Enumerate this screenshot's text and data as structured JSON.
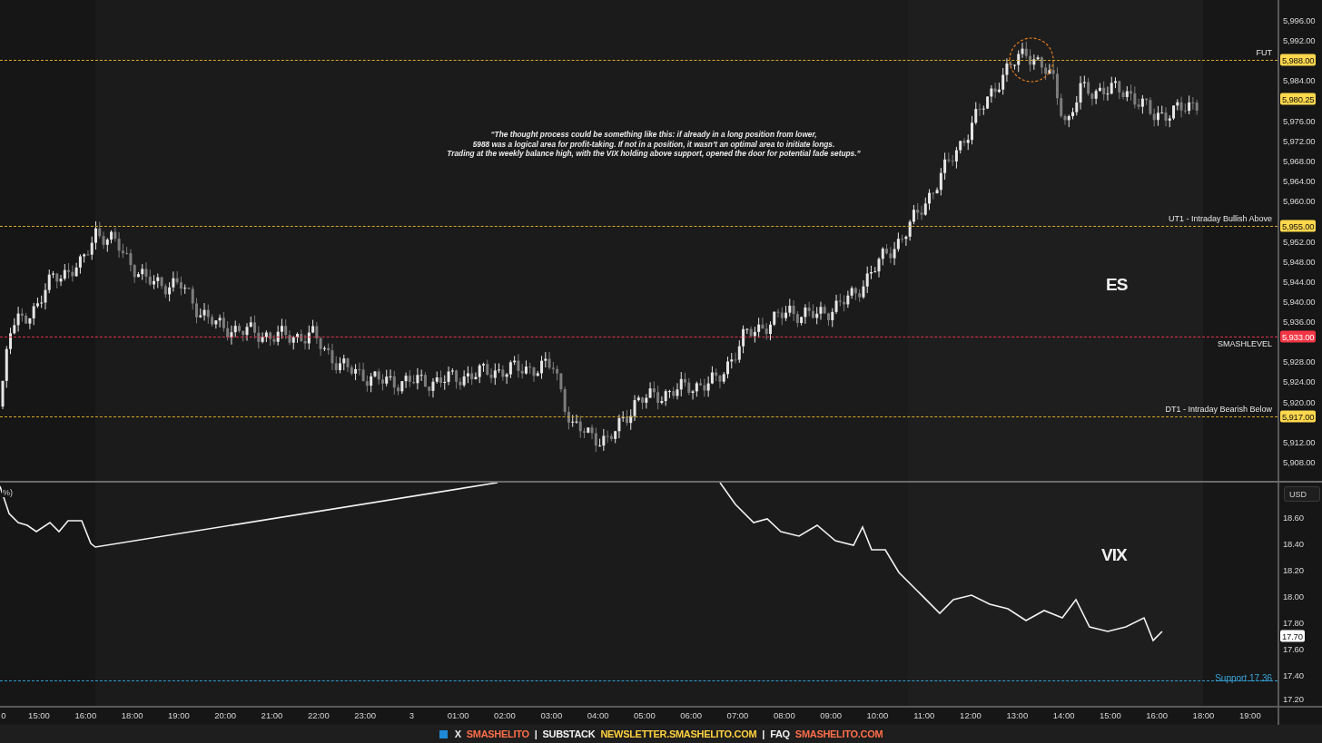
{
  "annotation": {
    "lines": [
      "“The thought process could be something like this: if already in a long position from lower,",
      "5988 was a logical area for profit-taking. If not in a position, it wasn’t an optimal area to initiate longs.",
      "Trading at the weekly balance high, with the VIX holding above support, opened the door for potential fade setups.”"
    ]
  },
  "es_pane": {
    "symbol": "ES",
    "price_ticks": [
      "5,996.00",
      "5,992.00",
      "5,984.00",
      "5,976.00",
      "5,972.00",
      "5,968.00",
      "5,964.00",
      "5,960.00",
      "5,952.00",
      "5,948.00",
      "5,944.00",
      "5,940.00",
      "5,936.00",
      "5,928.00",
      "5,924.00",
      "5,920.00",
      "5,912.00",
      "5,908.00"
    ],
    "levels": [
      {
        "label": "FUT",
        "tag": "5,988.00",
        "kind": "key"
      },
      {
        "label": "UT1 - Intraday Bullish Above",
        "tag": "5,955.00",
        "kind": "key"
      },
      {
        "label": "SMASHLEVEL",
        "tag": "5,933.00",
        "kind": "pivot"
      },
      {
        "label": "DT1 - Intraday Bearish Below",
        "tag": "5,917.00",
        "kind": "key"
      }
    ],
    "last_price": "5,980.25"
  },
  "vix_pane": {
    "symbol": "VIX",
    "legend": "%)",
    "currency": "USD",
    "price_ticks": [
      "18.60",
      "18.40",
      "18.20",
      "18.00",
      "17.80",
      "17.60",
      "17.40",
      "17.20"
    ],
    "support": {
      "label": "Support 17.36"
    },
    "last_price": "17.70"
  },
  "time_axis": [
    "0",
    "15:00",
    "16:00",
    "18:00",
    "19:00",
    "20:00",
    "21:00",
    "22:00",
    "23:00",
    "3",
    "01:00",
    "02:00",
    "03:00",
    "04:00",
    "05:00",
    "06:00",
    "07:00",
    "08:00",
    "09:00",
    "10:00",
    "11:00",
    "12:00",
    "13:00",
    "14:00",
    "15:00",
    "16:00",
    "18:00",
    "19:00"
  ],
  "footer": [
    {
      "text": "X",
      "kind": "label"
    },
    {
      "text": "SMASHELITO",
      "kind": "link",
      "color": "#ff6e4a"
    },
    {
      "text": "|",
      "kind": "label"
    },
    {
      "text": "SUBSTACK",
      "kind": "label"
    },
    {
      "text": "NEWSLETTER.SMASHELITO.COM",
      "kind": "link",
      "color": "#ffd23f"
    },
    {
      "text": "|",
      "kind": "label"
    },
    {
      "text": "FAQ",
      "kind": "label"
    },
    {
      "text": "SMASHELITO.COM",
      "kind": "link",
      "color": "#ff6e4a"
    }
  ]
}
